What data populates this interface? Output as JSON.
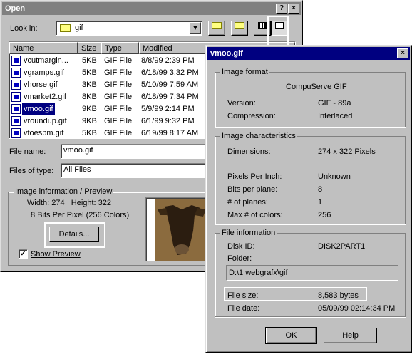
{
  "open_dialog": {
    "title": "Open",
    "help_button": "?",
    "close_button": "×",
    "look_in_label": "Look in:",
    "look_in_value": "gif",
    "columns": [
      "Name",
      "Size",
      "Type",
      "Modified"
    ],
    "files": [
      {
        "name": "vcutmargin...",
        "size": "5KB",
        "type": "GIF File",
        "modified": "8/8/99 2:39 PM"
      },
      {
        "name": "vgramps.gif",
        "size": "5KB",
        "type": "GIF File",
        "modified": "6/18/99 3:32 PM"
      },
      {
        "name": "vhorse.gif",
        "size": "3KB",
        "type": "GIF File",
        "modified": "5/10/99 7:59 AM"
      },
      {
        "name": "vmarket2.gif",
        "size": "8KB",
        "type": "GIF File",
        "modified": "6/18/99 7:34 PM"
      },
      {
        "name": "vmoo.gif",
        "size": "9KB",
        "type": "GIF File",
        "modified": "5/9/99 2:14 PM"
      },
      {
        "name": "vroundup.gif",
        "size": "9KB",
        "type": "GIF File",
        "modified": "6/1/99 9:32 PM"
      },
      {
        "name": "vtoespm.gif",
        "size": "5KB",
        "type": "GIF File",
        "modified": "6/19/99 8:17 AM"
      }
    ],
    "file_name_label": "File name:",
    "file_name_value": "vmoo.gif",
    "files_of_type_label": "Files of type:",
    "files_of_type_value": "All Files",
    "preview_group_label": "Image information / Preview",
    "width_line": "Width: 274   Height: 322",
    "bits_line": "8 Bits Per Pixel (256 Colors)",
    "details_button": "Details...",
    "show_preview_label": "Show Preview",
    "show_preview_checked": "✓"
  },
  "info_dialog": {
    "title": "vmoo.gif",
    "close_button": "×",
    "image_format": {
      "group_label": "Image format",
      "format_name": "CompuServe GIF",
      "version_label": "Version:",
      "version_value": "GIF - 89a",
      "compression_label": "Compression:",
      "compression_value": "Interlaced"
    },
    "image_characteristics": {
      "group_label": "Image characteristics",
      "dimensions_label": "Dimensions:",
      "dimensions_value": "274 x 322 Pixels",
      "ppi_label": "Pixels Per Inch:",
      "ppi_value": "Unknown",
      "bpp_label": "Bits per plane:",
      "bpp_value": "8",
      "planes_label": "# of planes:",
      "planes_value": "1",
      "colors_label": "Max # of colors:",
      "colors_value": "256"
    },
    "file_information": {
      "group_label": "File information",
      "disk_label": "Disk ID:",
      "disk_value": "DISK2PART1",
      "folder_label": "Folder:",
      "folder_value": "D:\\1 webgrafx\\gif",
      "size_label": "File size:",
      "size_value": "8,583 bytes",
      "date_label": "File date:",
      "date_value": "05/09/99 02:14:34 PM"
    },
    "ok_button": "OK",
    "help_button": "Help"
  },
  "colors": {
    "face": "#c0c0c0",
    "active_title": "#000080",
    "inactive_title": "#808080",
    "selection": "#000080",
    "preview_tint": "#8b6b3e"
  }
}
